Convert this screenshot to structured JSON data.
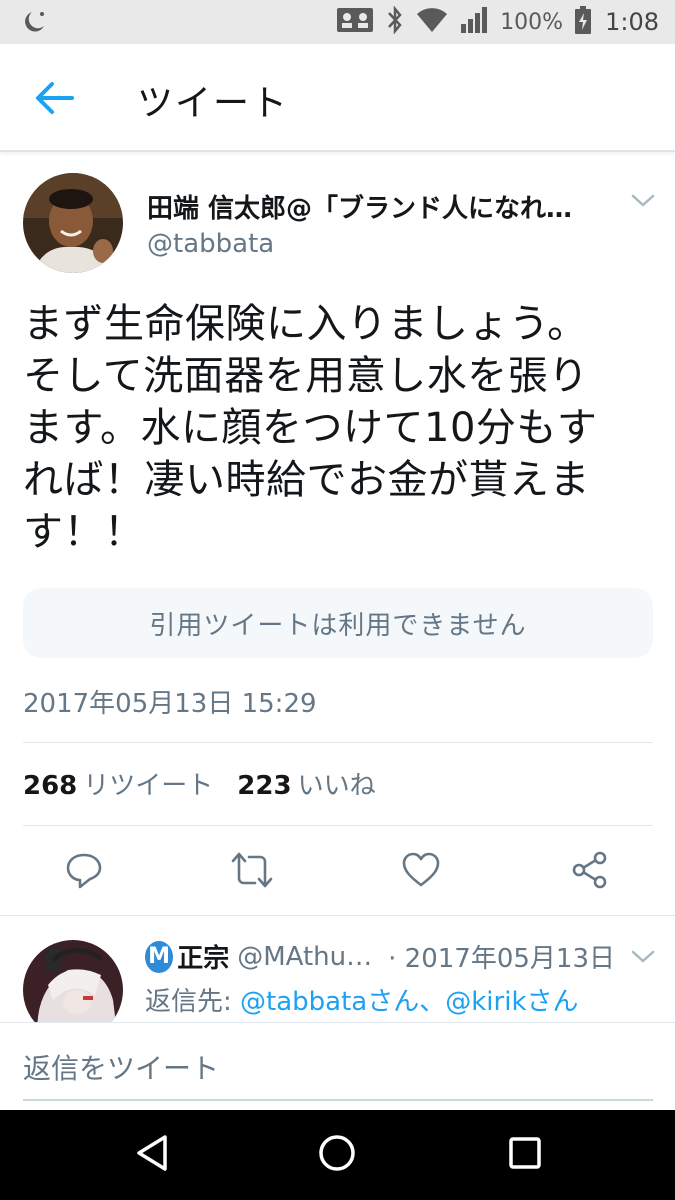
{
  "status_bar": {
    "battery": "100%",
    "time": "1:08",
    "icons": [
      "moon-icon",
      "sim-card-icon",
      "bluetooth-icon",
      "wifi-icon",
      "signal-icon",
      "battery-icon"
    ]
  },
  "header": {
    "title": "ツイート",
    "back_icon": "back-arrow-icon"
  },
  "tweet": {
    "author_name": "田端 信太郎@「ブランド人になれ…",
    "author_handle": "@tabbata",
    "text_lines": [
      "まず生命保険に入りましょう。",
      "そして洗面器を用意し水を張り",
      "ます。水に顔をつけて10分もす",
      "れば！凄い時給でお金が貰えま",
      "す！！"
    ],
    "quote_unavailable": "引用ツイートは利用できません",
    "date": "2017年05月13日 15:29",
    "retweet_count": "268",
    "retweet_label": "リツイート",
    "like_count": "223",
    "like_label": "いいね",
    "actions": [
      "reply-icon",
      "retweet-icon",
      "like-icon",
      "share-icon"
    ]
  },
  "reply": {
    "badge": "M",
    "name": "正宗",
    "handle": "@MAthu…",
    "date": "· 2017年05月13日",
    "reply_to_label": "返信先:",
    "reply_to_user1": "@tabbataさん",
    "separator": "、",
    "reply_to_user2": "@kirikさん"
  },
  "compose": {
    "placeholder": "返信をツイート"
  },
  "colors": {
    "accent": "#1da1f2",
    "secondary_text": "#657786",
    "primary_text": "#14171a"
  }
}
